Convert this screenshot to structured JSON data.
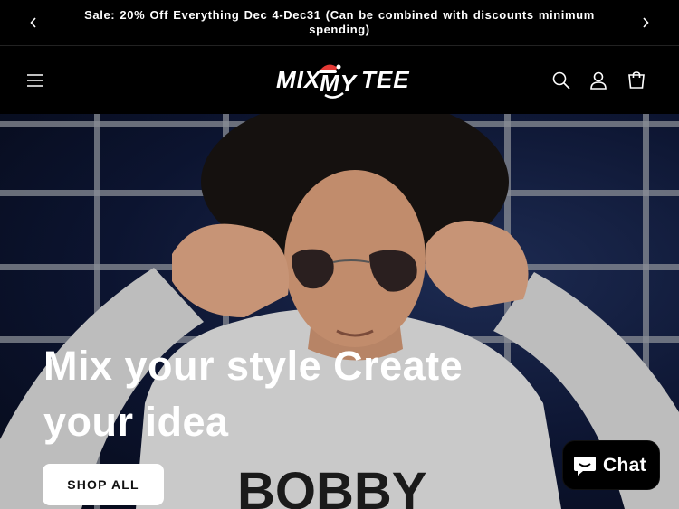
{
  "announcement": {
    "message": "Sale: 20% Off Everything      Dec 4-Dec31      (Can be combined with discounts minimum spending)"
  },
  "header": {
    "logo_text": "MIX MY TEE",
    "icons": [
      "menu-icon",
      "search-icon",
      "account-icon",
      "cart-icon"
    ]
  },
  "hero": {
    "title": "Mix your style Create your idea",
    "button_label": "SHOP ALL",
    "shirt_text": "BOBBY"
  },
  "chat": {
    "label": "Chat"
  },
  "colors": {
    "bar_bg": "#000000",
    "button_bg": "#ffffff",
    "sweater": "#c9c9c9",
    "hat_red": "#e53935"
  }
}
